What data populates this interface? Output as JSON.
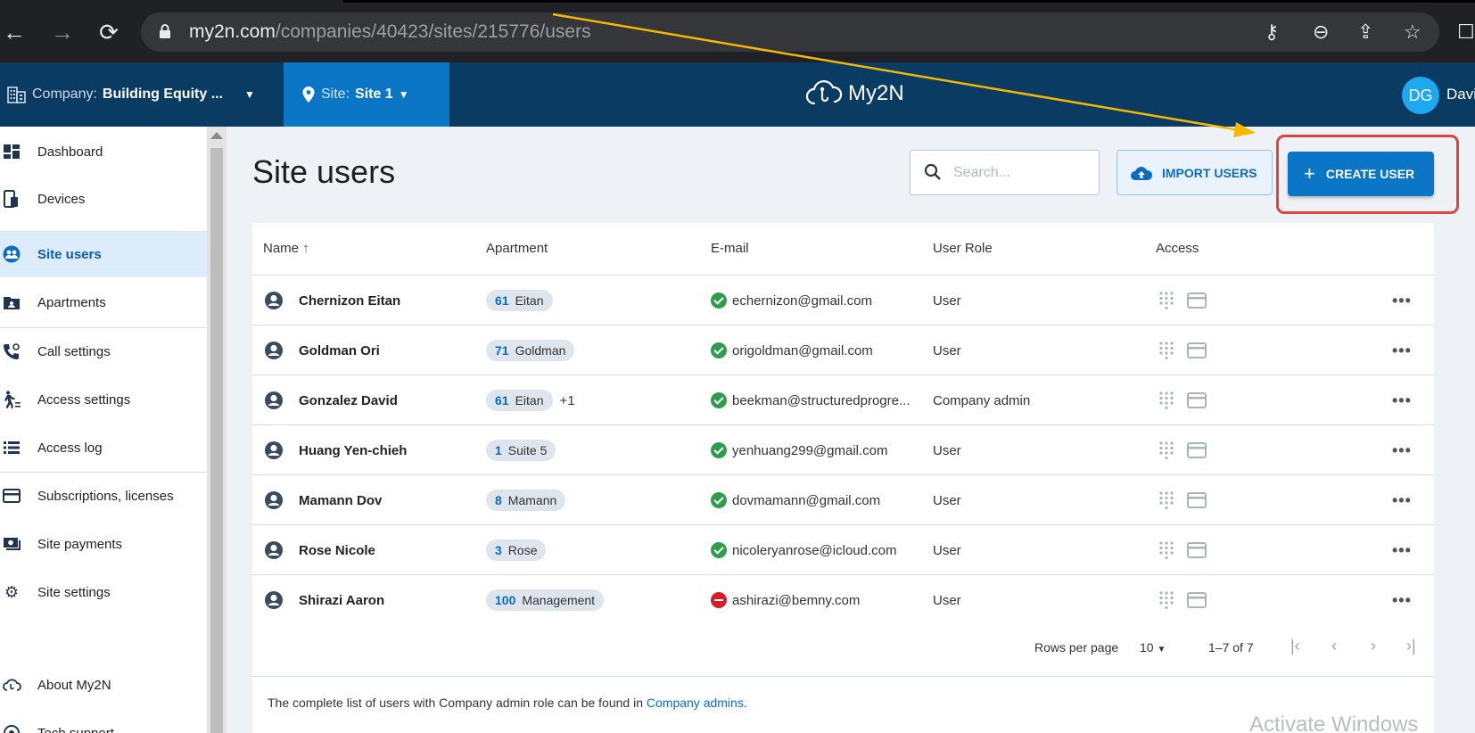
{
  "browser": {
    "url_domain": "my2n.com",
    "url_path": "/companies/40423/sites/215776/users"
  },
  "header": {
    "company_prefix": "Company:",
    "company_name": "Building Equity ...",
    "site_prefix": "Site:",
    "site_name": "Site 1",
    "logo_text": "My2N",
    "avatar_initials": "DG",
    "user_name": "Davi"
  },
  "sidebar": {
    "items": [
      {
        "label": "Dashboard",
        "icon": "dashboard-icon"
      },
      {
        "label": "Devices",
        "icon": "devices-icon"
      },
      {
        "label": "Site users",
        "icon": "site-users-icon",
        "active": true
      },
      {
        "label": "Apartments",
        "icon": "apartments-icon"
      },
      {
        "label": "Call settings",
        "icon": "call-settings-icon"
      },
      {
        "label": "Access settings",
        "icon": "access-settings-icon"
      },
      {
        "label": "Access log",
        "icon": "access-log-icon"
      },
      {
        "label": "Subscriptions, licenses",
        "icon": "credit-card-icon"
      },
      {
        "label": "Site payments",
        "icon": "payments-icon"
      },
      {
        "label": "Site settings",
        "icon": "gear-icon"
      },
      {
        "label": "About My2N",
        "icon": "cloud-icon"
      },
      {
        "label": "Tech support",
        "icon": "support-icon"
      }
    ]
  },
  "main": {
    "title": "Site users",
    "search_placeholder": "Search...",
    "import_label": "IMPORT USERS",
    "create_label": "CREATE USER"
  },
  "table": {
    "columns": [
      "Name",
      "Apartment",
      "E-mail",
      "User Role",
      "Access"
    ],
    "rows": [
      {
        "name": "Chernizon Eitan",
        "apt_num": "61",
        "apt_name": "Eitan",
        "extra": "",
        "email": "echernizon@gmail.com",
        "email_status": "ok",
        "role": "User"
      },
      {
        "name": "Goldman Ori",
        "apt_num": "71",
        "apt_name": "Goldman",
        "extra": "",
        "email": "origoldman@gmail.com",
        "email_status": "ok",
        "role": "User"
      },
      {
        "name": "Gonzalez David",
        "apt_num": "61",
        "apt_name": "Eitan",
        "extra": "+1",
        "email": "beekman@structuredprogre...",
        "email_status": "ok",
        "role": "Company admin"
      },
      {
        "name": "Huang Yen-chieh",
        "apt_num": "1",
        "apt_name": "Suite 5",
        "extra": "",
        "email": "yenhuang299@gmail.com",
        "email_status": "ok",
        "role": "User"
      },
      {
        "name": "Mamann Dov",
        "apt_num": "8",
        "apt_name": "Mamann",
        "extra": "",
        "email": "dovmamann@gmail.com",
        "email_status": "ok",
        "role": "User"
      },
      {
        "name": "Rose Nicole",
        "apt_num": "3",
        "apt_name": "Rose",
        "extra": "",
        "email": "nicoleryanrose@icloud.com",
        "email_status": "ok",
        "role": "User"
      },
      {
        "name": "Shirazi Aaron",
        "apt_num": "100",
        "apt_name": "Management",
        "extra": "",
        "email": "ashirazi@bemny.com",
        "email_status": "error",
        "role": "User"
      }
    ],
    "more_label": "•••"
  },
  "pagination": {
    "rows_per_page_label": "Rows per page",
    "rows_per_page_value": "10",
    "range": "1–7 of 7"
  },
  "footer": {
    "note_text": "The complete list of users with Company admin role can be found in",
    "note_link": "Company admins",
    "note_end": "."
  },
  "watermark": "Activate Windows",
  "colors": {
    "accent": "#0b76c6",
    "header_bg": "#0a3b62",
    "highlight": "#d9483b",
    "arrow": "#f5b800"
  }
}
